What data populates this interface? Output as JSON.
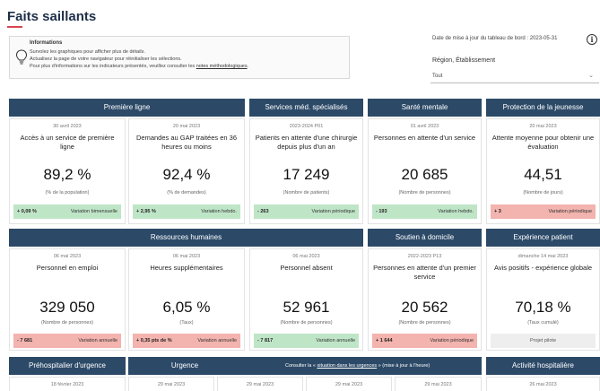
{
  "page": {
    "title": "Faits saillants"
  },
  "info": {
    "title": "Informations",
    "line1": "Survolez les graphiques pour afficher plus de détails.",
    "line2": "Actualisez la page de votre navigateur pour réinitialiser les sélections.",
    "line3": "Pour plus d'informations sur les indicateurs présentés, veuillez consulter les",
    "link": "notes méthodologiques",
    "icon": "lightbulb-icon"
  },
  "update": {
    "text": "Date de mise à jour du tableau de bord : 2023-05-31",
    "icon_glyph": "i"
  },
  "filter": {
    "label": "Région, Établissement",
    "value": "Tout",
    "chevron": "⌄"
  },
  "sections": {
    "premiere_ligne": "Première ligne",
    "services_med": "Services méd. spécialisés",
    "sante_mentale": "Santé mentale",
    "protection": "Protection de la jeunesse",
    "rh": "Ressources humaines",
    "soutien": "Soutien à domicile",
    "experience": "Expérience patient",
    "prehospitalier": "Préhospitalier d'urgence",
    "urgence": "Urgence",
    "activite": "Activité hospitalière"
  },
  "urgence_link": {
    "prefix": "Consulter la « ",
    "link": "situation dans les urgences",
    "suffix": " » (mise à jour à l'heure)"
  },
  "cards": {
    "c1": {
      "date": "30 avril 2023",
      "label": "Accès à un service de première ligne",
      "value": "89,2 %",
      "unit": "(% de la population)",
      "var_value": "+ 0,09 %",
      "var_text": "Variation bimensuelle"
    },
    "c2": {
      "date": "20 mai 2023",
      "label": "Demandes au GAP traitées en 36 heures ou moins",
      "value": "92,4 %",
      "unit": "(% de demandes)",
      "var_value": "+ 2,95 %",
      "var_text": "Variation hebdo."
    },
    "c3": {
      "date": "2023-2024 P01",
      "label": "Patients en attente d'une chirurgie depuis plus d'un an",
      "value": "17 249",
      "unit": "(Nombre de patients)",
      "var_value": "- 263",
      "var_text": "Variation périodique"
    },
    "c4": {
      "date": "01 avril 2023",
      "label": "Personnes en attente d'un service",
      "value": "20 685",
      "unit": "(Nombre de personnes)",
      "var_value": "- 193",
      "var_text": "Variation hebdo."
    },
    "c5": {
      "date": "20 mai 2023",
      "label": "Attente moyenne pour obtenir une évaluation",
      "value": "44,51",
      "unit": "(Nombre de jours)",
      "var_value": "+ 3",
      "var_text": "Variation périodique"
    },
    "c6": {
      "date": "06 mai 2023",
      "label": "Personnel en emploi",
      "value": "329 050",
      "unit": "(Nombre de personnes)",
      "var_value": "- 7 681",
      "var_text": "Variation annuelle"
    },
    "c7": {
      "date": "06 mai 2023",
      "label": "Heures supplémentaires",
      "value": "6,05 %",
      "unit": "(Taux)",
      "var_value": "+ 0,35 pts de %",
      "var_text": "Variation annuelle"
    },
    "c8": {
      "date": "06 mai 2023",
      "label": "Personnel absent",
      "value": "52 961",
      "unit": "(Nombre de personnes)",
      "var_value": "- 7 817",
      "var_text": "Variation annuelle"
    },
    "c9": {
      "date": "2022-2023 P13",
      "label": "Personnes en attente d'un premier service",
      "value": "20 562",
      "unit": "(Nombre de personnes)",
      "var_value": "+ 1 644",
      "var_text": "Variation périodique"
    },
    "c10": {
      "date": "dimanche 14 mai 2023",
      "label": "Avis positifs - expérience globale",
      "value": "70,18 %",
      "unit": "(Taux cumulé)",
      "var_text": "Projet pilote"
    },
    "c11": {
      "date": "18 février 2023"
    },
    "c12": {
      "date": "29 mai 2023"
    },
    "c13": {
      "date": "29 mai 2023"
    },
    "c14": {
      "date": "29 mai 2023"
    },
    "c15": {
      "date": "29 mai 2023"
    },
    "c16": {
      "date": "26 mai 2023"
    }
  },
  "colors": {
    "header": "#2c4a68",
    "positive": "#bfe5c7",
    "negative": "#f3b3ae",
    "accent": "#d64550"
  }
}
